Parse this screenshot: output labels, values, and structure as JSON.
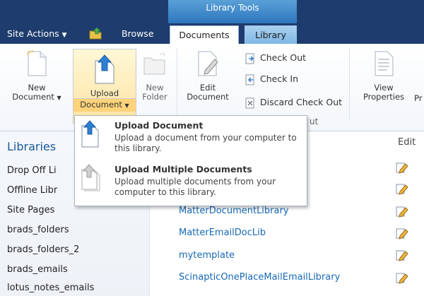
{
  "topbar": {
    "library_tools": "Library Tools",
    "site_actions": "Site Actions",
    "browse": "Browse",
    "documents_tab": "Documents",
    "library_tab": "Library"
  },
  "ribbon": {
    "new_document": [
      "New",
      "Document"
    ],
    "upload_document": [
      "Upload",
      "Document"
    ],
    "new_folder": [
      "New",
      "Folder"
    ],
    "edit_document": [
      "Edit",
      "Document"
    ],
    "check_out": "Check Out",
    "check_in": "Check In",
    "discard_check_out": "Discard Check Out",
    "group_tail": "ut",
    "view_properties": [
      "View",
      "Properties"
    ],
    "cutoff_text": "Pr"
  },
  "dropdown": {
    "items": [
      {
        "title": "Upload Document",
        "description": "Upload a document from your computer to this library."
      },
      {
        "title": "Upload Multiple Documents",
        "description": "Upload multiple documents from your computer to this library."
      }
    ]
  },
  "leftnav": {
    "heading": "Libraries",
    "items": [
      "Drop Off Li",
      "Offline Libr",
      "Site Pages",
      "brads_folders",
      "brads_folders_2",
      "brads_emails",
      "lotus_notes_emails"
    ]
  },
  "main": {
    "edit_column": "Edit",
    "libraries": [
      "MatterDocumentLibrary",
      "MatterEmailDocLib",
      "mytemplate",
      "ScinapticOnePlaceMailEmailLibrary"
    ]
  },
  "colors": {
    "topbar": "#1e3c6e",
    "accent": "#2d77bd",
    "link": "#1769b5",
    "upload_highlight": "#ffd37a"
  }
}
